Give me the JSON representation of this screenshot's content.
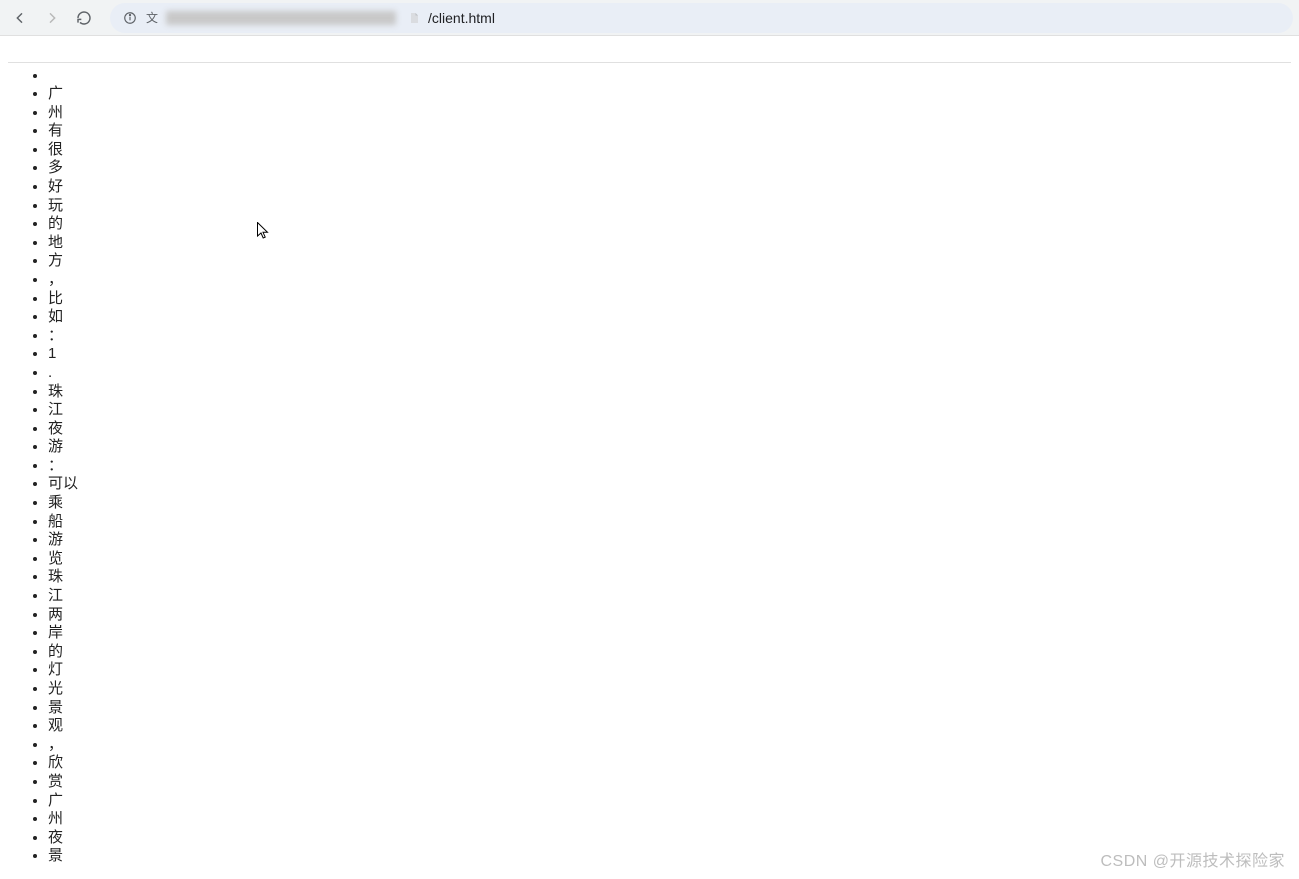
{
  "browser": {
    "url_prefix_icon_label": "文",
    "url_visible": "/client.html"
  },
  "list_items": [
    "",
    "广",
    "州",
    "有",
    "很",
    "多",
    "好",
    "玩",
    "的",
    "地",
    "方",
    "，",
    "比",
    "如",
    "：",
    "1",
    ".",
    "珠",
    "江",
    "夜",
    "游",
    "：",
    "可以",
    "乘",
    "船",
    "游",
    "览",
    "珠",
    "江",
    "两",
    "岸",
    "的",
    "灯",
    "光",
    "景",
    "观",
    "，",
    "欣",
    "赏",
    "广",
    "州",
    "夜",
    "景"
  ],
  "watermark": "CSDN @开源技术探险家"
}
